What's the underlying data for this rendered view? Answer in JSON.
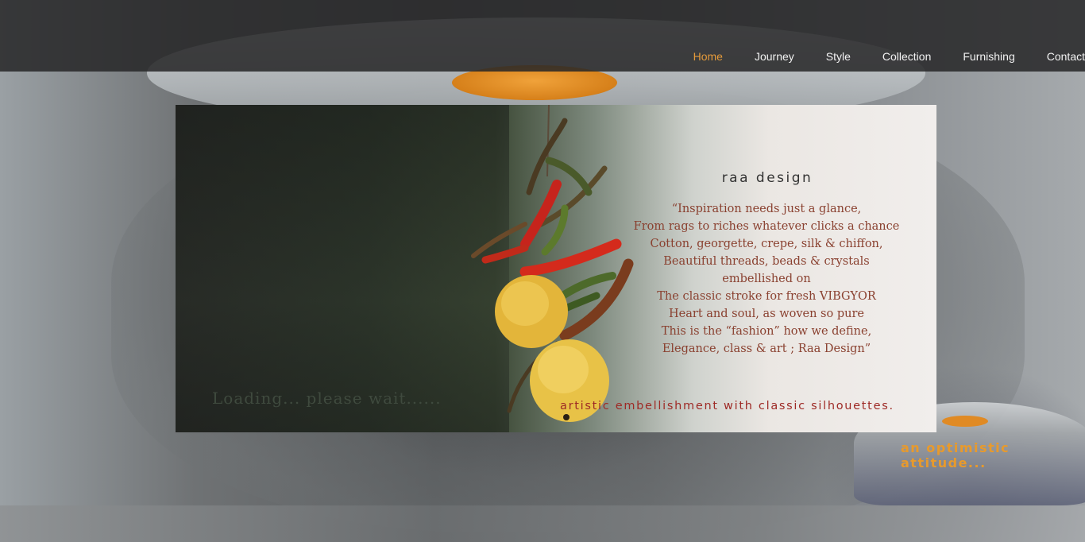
{
  "nav": {
    "items": [
      {
        "label": "Home",
        "active": true
      },
      {
        "label": "Journey",
        "active": false
      },
      {
        "label": "Style",
        "active": false
      },
      {
        "label": "Collection",
        "active": false
      },
      {
        "label": "Furnishing",
        "active": false
      },
      {
        "label": "Contact",
        "active": false
      }
    ]
  },
  "banner": {
    "loading_text": "Loading... please wait......",
    "brand": "raa design",
    "poem": [
      "“Inspiration needs just a glance,",
      "From rags to riches whatever clicks a chance",
      "Cotton, georgette, crepe, silk & chiffon,",
      "Beautiful threads, beads & crystals",
      "embellished on",
      "The classic stroke for fresh VIBGYOR",
      "Heart and soul, as woven so pure",
      "This is the “fashion” how we define,",
      "Elegance, class & art ; Raa Design”"
    ],
    "tagline": "artistic embellishment with classic silhouettes."
  },
  "footer_tagline": "an optimistic attitude...",
  "colors": {
    "accent_orange": "#e59a3b",
    "poem_brown": "#8a4130",
    "tagline_red": "#9e2a26",
    "header_bg": "#262728"
  }
}
